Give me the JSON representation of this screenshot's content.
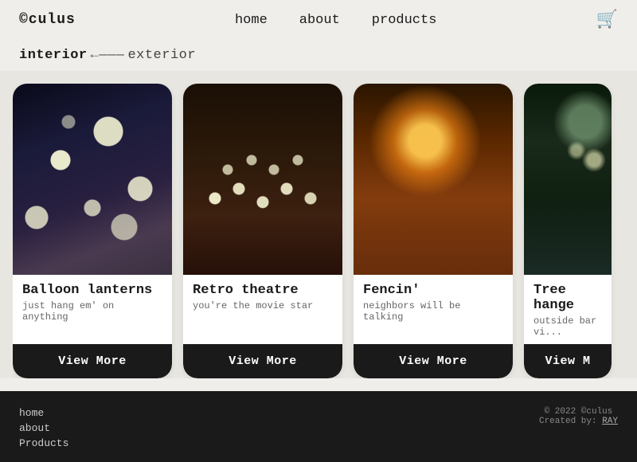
{
  "header": {
    "logo": "©culus",
    "nav": {
      "home": "home",
      "about": "about",
      "products": "products"
    },
    "cart_icon": "🛒"
  },
  "filter": {
    "active": "interior",
    "arrow": "←———",
    "inactive": "exterior"
  },
  "products": [
    {
      "id": "balloon",
      "title": "Balloon lanterns",
      "subtitle": "just hang em' on anything",
      "btn": "View More",
      "img_class": "img-balloon"
    },
    {
      "id": "retro",
      "title": "Retro theatre",
      "subtitle": "you're the movie star",
      "btn": "View More",
      "img_class": "img-retro"
    },
    {
      "id": "fencing",
      "title": "Fencin'",
      "subtitle": "neighbors will be talking",
      "btn": "View More",
      "img_class": "img-fencing"
    },
    {
      "id": "treehang",
      "title": "Tree hange",
      "subtitle": "outside bar vi...",
      "btn": "View M",
      "img_class": "img-treehang",
      "partial": true
    }
  ],
  "footer": {
    "links": [
      "home",
      "about",
      "Products"
    ],
    "copyright": "© 2022 ©culus",
    "created_by": "Created by: ",
    "creator_name": "RAY"
  }
}
